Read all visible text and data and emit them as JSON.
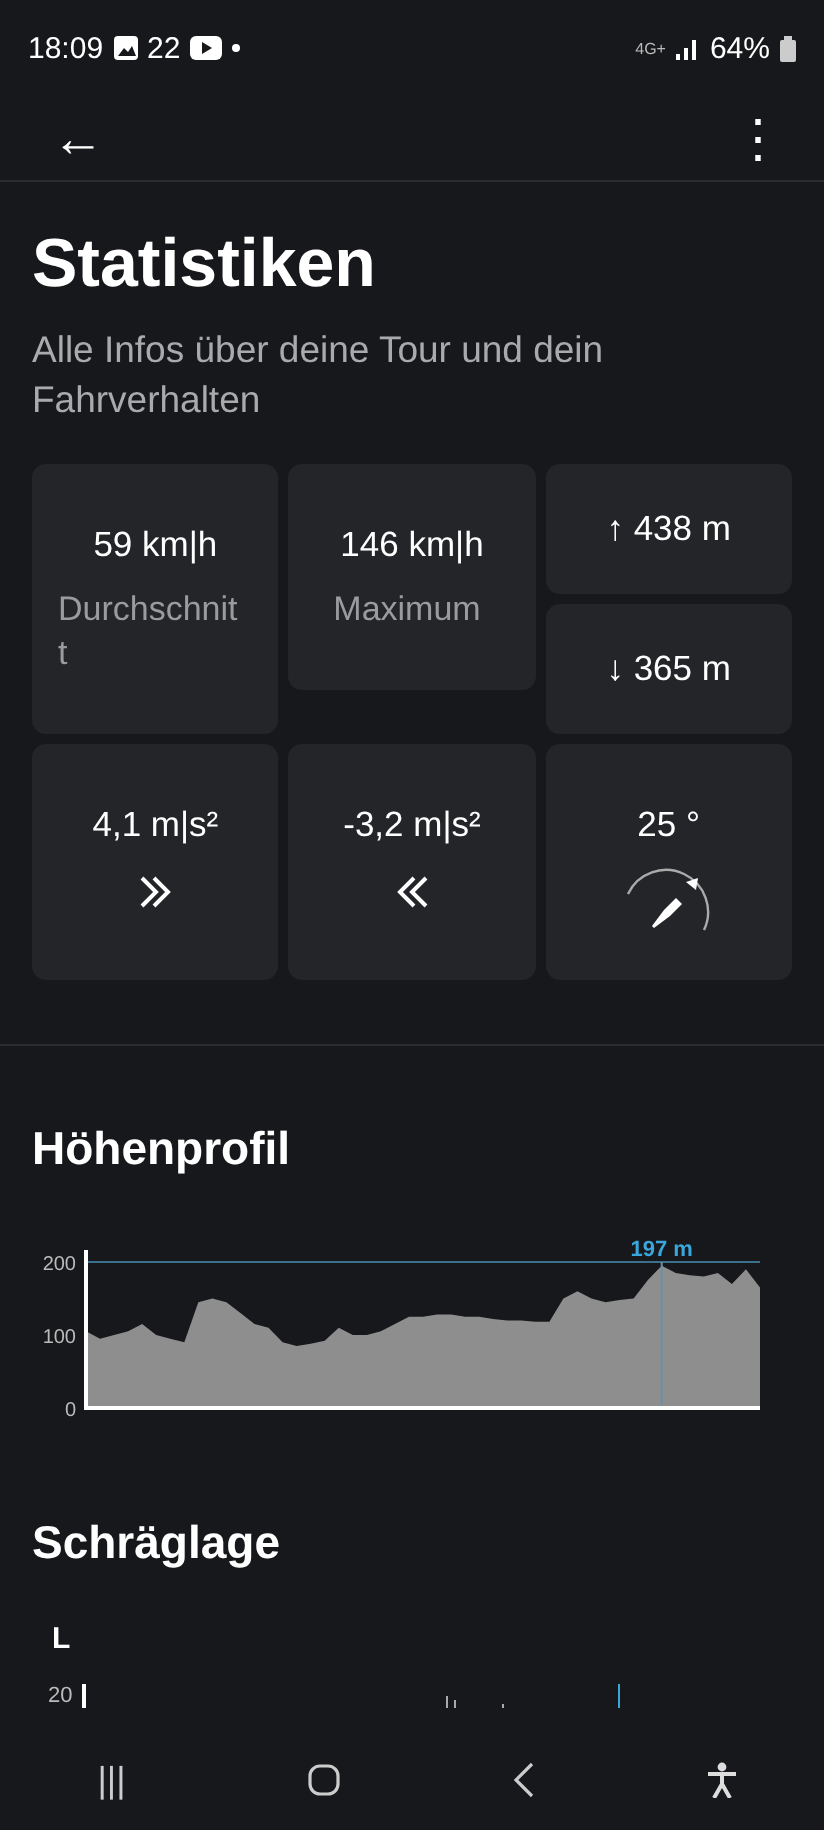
{
  "status_bar": {
    "time": "18:09",
    "notification_count": "22",
    "network": "4G+",
    "battery": "64%"
  },
  "app_bar": {
    "back": "←",
    "menu": "⋮"
  },
  "title": "Statistiken",
  "subtitle": "Alle Infos über deine Tour und dein Fahrverhalten",
  "stats": [
    {
      "kind": "speed",
      "value": "59 km|h",
      "label": "Durchschnitt"
    },
    {
      "kind": "speed",
      "value": "146 km|h",
      "label": "Maximum"
    },
    {
      "kind": "climb",
      "ascent": "↑ 438 m",
      "descent": "↓ 365 m"
    },
    {
      "kind": "accel",
      "value": "4,1 m|s²"
    },
    {
      "kind": "brake",
      "value": "-3,2 m|s²"
    },
    {
      "kind": "lean",
      "value": "25 °"
    }
  ],
  "elevation": {
    "title": "Höhenprofil",
    "chart_data": {
      "type": "area",
      "ylim": [
        0,
        200
      ],
      "yticks": [
        0,
        100,
        200
      ],
      "values": [
        105,
        95,
        100,
        105,
        115,
        100,
        95,
        90,
        145,
        150,
        145,
        130,
        115,
        110,
        90,
        85,
        88,
        92,
        110,
        100,
        100,
        105,
        115,
        125,
        125,
        128,
        128,
        125,
        125,
        122,
        120,
        120,
        118,
        118,
        150,
        160,
        150,
        145,
        148,
        150,
        175,
        195,
        185,
        182,
        180,
        185,
        170,
        190,
        165
      ],
      "annotations": [
        {
          "text": "197 m"
        }
      ]
    }
  },
  "lean": {
    "title": "Schräglage",
    "side_label": "L",
    "tick": "20"
  },
  "nav_bar": {
    "recents": "|||"
  }
}
